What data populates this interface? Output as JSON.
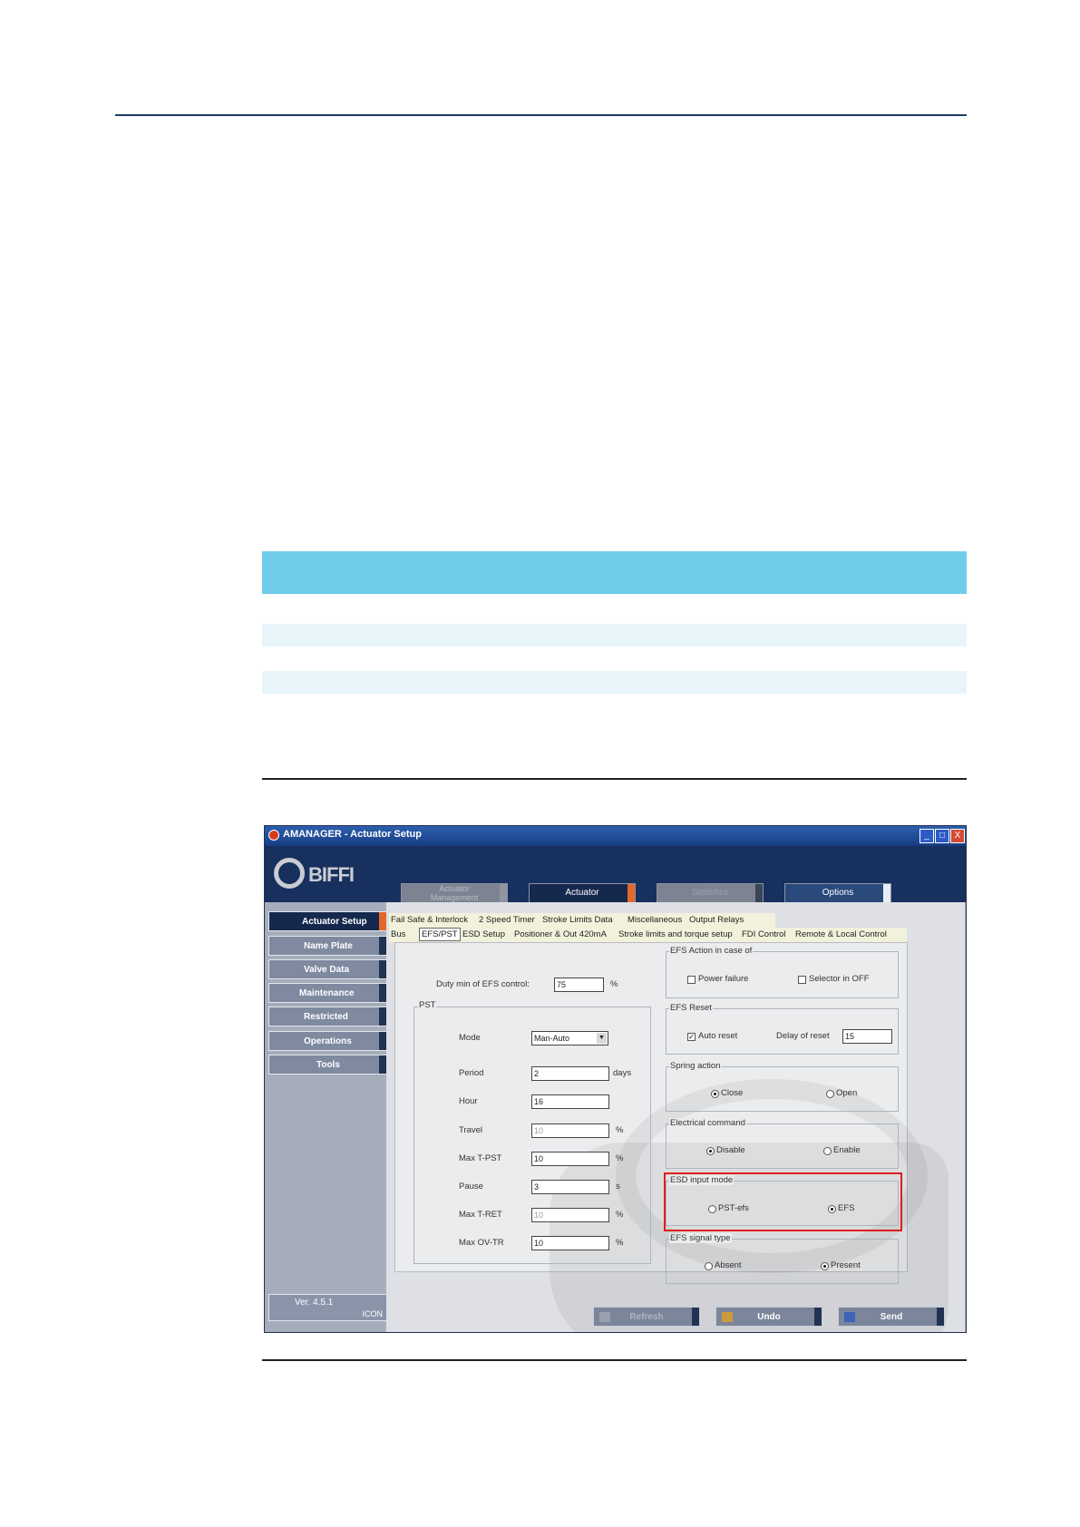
{
  "window": {
    "title": "AMANAGER - Actuator Setup",
    "logo": "BIFFI",
    "controls": [
      "_",
      "□",
      "X"
    ]
  },
  "nav": [
    {
      "label": "Actuator Management",
      "state": "disabled",
      "accent": "#8f95a1"
    },
    {
      "label": "Actuator",
      "state": "active",
      "accent": "#e3682a"
    },
    {
      "label": "Statistics",
      "state": "disabled",
      "accent": "#8f95a1"
    },
    {
      "label": "Options",
      "state": "normal",
      "accent": "#ffffff"
    }
  ],
  "sidebar": {
    "items": [
      "Actuator Setup",
      "Name Plate",
      "Valve Data",
      "Maintenance",
      "Restricted",
      "Operations",
      "Tools"
    ],
    "active": "Actuator Setup",
    "version": "Ver.  4.5.1",
    "version_sub": "ICON"
  },
  "tabs": {
    "row1": [
      "Fail Safe & Interlock",
      "2 Speed Timer",
      "Stroke Limits Data",
      "Miscellaneous",
      "Output Relays"
    ],
    "row2": [
      "Bus",
      "EFS/PST",
      "ESD Setup",
      "Positioner & Out 420mA",
      "Stroke limits and torque setup",
      "FDI Control",
      "Remote & Local Control"
    ],
    "selected": "EFS/PST"
  },
  "efs": {
    "duty_label": "Duty min of EFS control:",
    "duty_value": "75",
    "duty_unit": "%"
  },
  "pst": {
    "group_title": "PST",
    "fields": [
      {
        "label": "Mode",
        "value": "Man-Auto",
        "unit": "",
        "type": "select"
      },
      {
        "label": "Period",
        "value": "2",
        "unit": "days"
      },
      {
        "label": "Hour",
        "value": "16",
        "unit": ""
      },
      {
        "label": "Travel",
        "value": "10",
        "unit": "%",
        "disabled": true
      },
      {
        "label": "Max T-PST",
        "value": "10",
        "unit": "%"
      },
      {
        "label": "Pause",
        "value": "3",
        "unit": "s"
      },
      {
        "label": "Max T-RET",
        "value": "10",
        "unit": "%",
        "disabled": true
      },
      {
        "label": "Max OV-TR",
        "value": "10",
        "unit": "%"
      }
    ]
  },
  "right_groups": {
    "efs_action": {
      "title": "EFS Action in case of",
      "opt1": "Power failure",
      "opt2": "Selector in OFF"
    },
    "efs_reset": {
      "title": "EFS Reset",
      "opt1": "Auto reset",
      "delay_label": "Delay of reset",
      "delay_value": "15"
    },
    "spring": {
      "title": "Spring action",
      "opt1": "Close",
      "opt2": "Open"
    },
    "electrical": {
      "title": "Electrical command",
      "opt1": "Disable",
      "opt2": "Enable"
    },
    "esd_input": {
      "title": "ESD input mode",
      "opt1": "PST-efs",
      "opt2": "EFS"
    },
    "efs_signal": {
      "title": "EFS signal type",
      "opt1": "Absent",
      "opt2": "Present"
    }
  },
  "bottom_buttons": [
    "Refresh",
    "Undo",
    "Send"
  ]
}
